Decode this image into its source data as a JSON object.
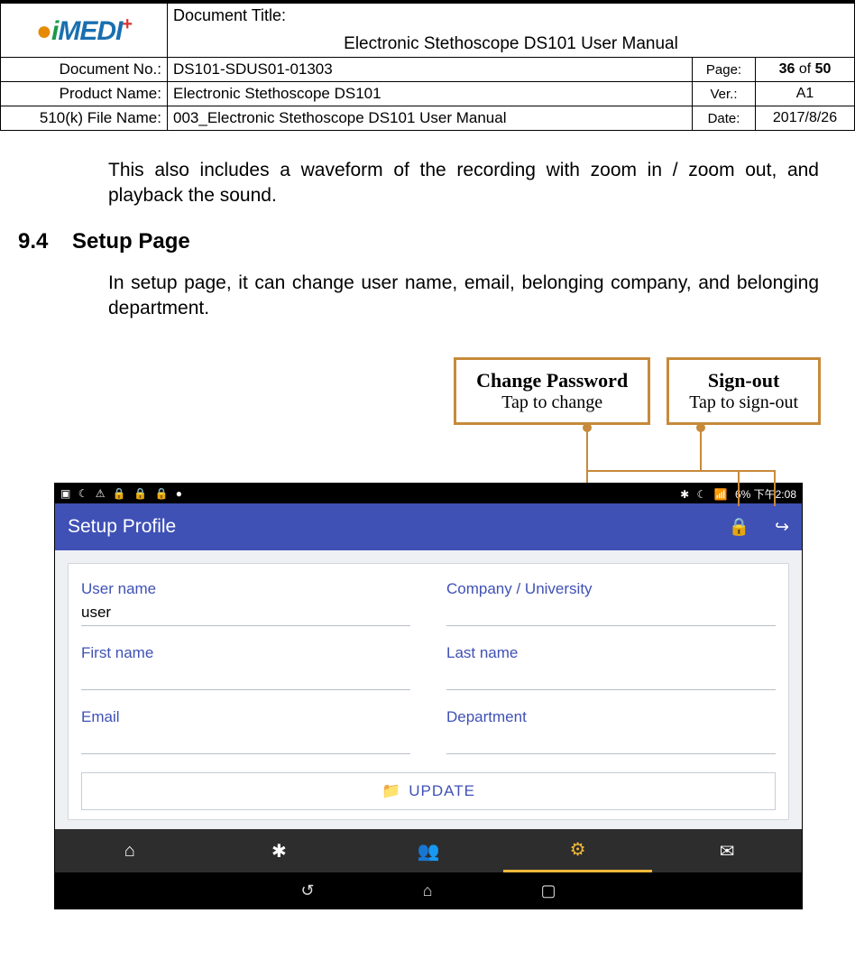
{
  "header": {
    "doc_title_label": "Document Title:",
    "doc_title_value": "Electronic Stethoscope DS101 User Manual",
    "doc_no_label": "Document No.:",
    "doc_no_value": "DS101-SDUS01-01303",
    "page_label": "Page:",
    "page_cur": "36",
    "page_of": " of ",
    "page_tot": "50",
    "prod_label": "Product Name:",
    "prod_value": "Electronic Stethoscope DS101",
    "ver_label": "Ver.:",
    "ver_value": "A1",
    "file_label": "510(k) File Name:",
    "file_value": "003_Electronic Stethoscope DS101 User Manual",
    "date_label": "Date:",
    "date_value": "2017/8/26"
  },
  "body": {
    "para1": "This also includes a waveform of the recording with zoom in / zoom out, and playback the sound.",
    "sec_num": "9.4",
    "sec_title": "Setup Page",
    "para2": "In setup page, it can change user name, email, belonging company, and belonging department."
  },
  "callouts": {
    "cp_title": "Change Password",
    "cp_sub": "Tap to change",
    "so_title": "Sign-out",
    "so_sub": "Tap to sign-out"
  },
  "phone": {
    "status_right": "6%   下午2:08",
    "appbar_title": "Setup Profile",
    "fields": {
      "user_label": "User name",
      "user_value": "user",
      "company_label": "Company / University",
      "first_label": "First name",
      "last_label": "Last name",
      "email_label": "Email",
      "dept_label": "Department"
    },
    "update_label": "UPDATE"
  }
}
